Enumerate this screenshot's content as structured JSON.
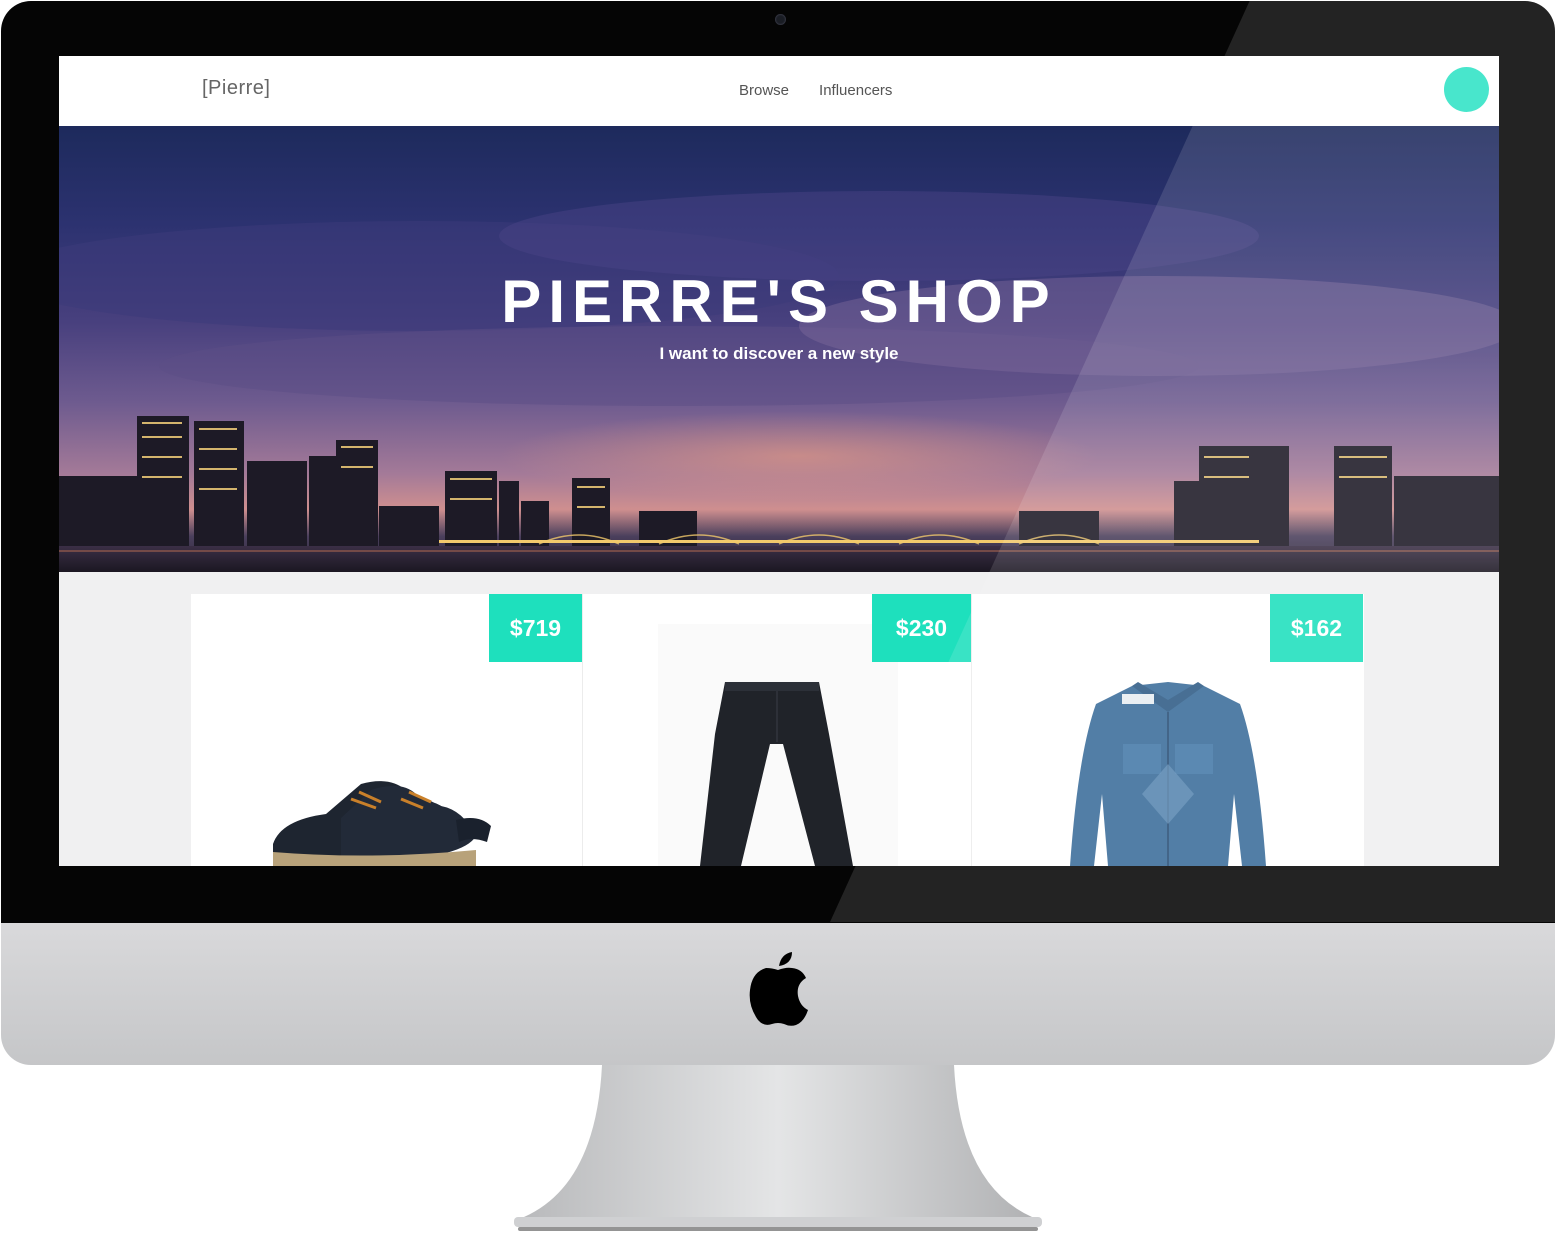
{
  "site": {
    "logo": "[Pierre]",
    "nav": [
      {
        "label": "Browse"
      },
      {
        "label": "Influencers"
      }
    ],
    "accent_color": "#2fe3c5"
  },
  "hero": {
    "title": "PIERRE'S SHOP",
    "subtitle": "I want to discover a new style"
  },
  "products": [
    {
      "price": "$719",
      "item": "sneakers"
    },
    {
      "price": "$230",
      "item": "jeans"
    },
    {
      "price": "$162",
      "item": "denim-shirt"
    }
  ],
  "device": {
    "icon": "apple-logo-icon"
  }
}
